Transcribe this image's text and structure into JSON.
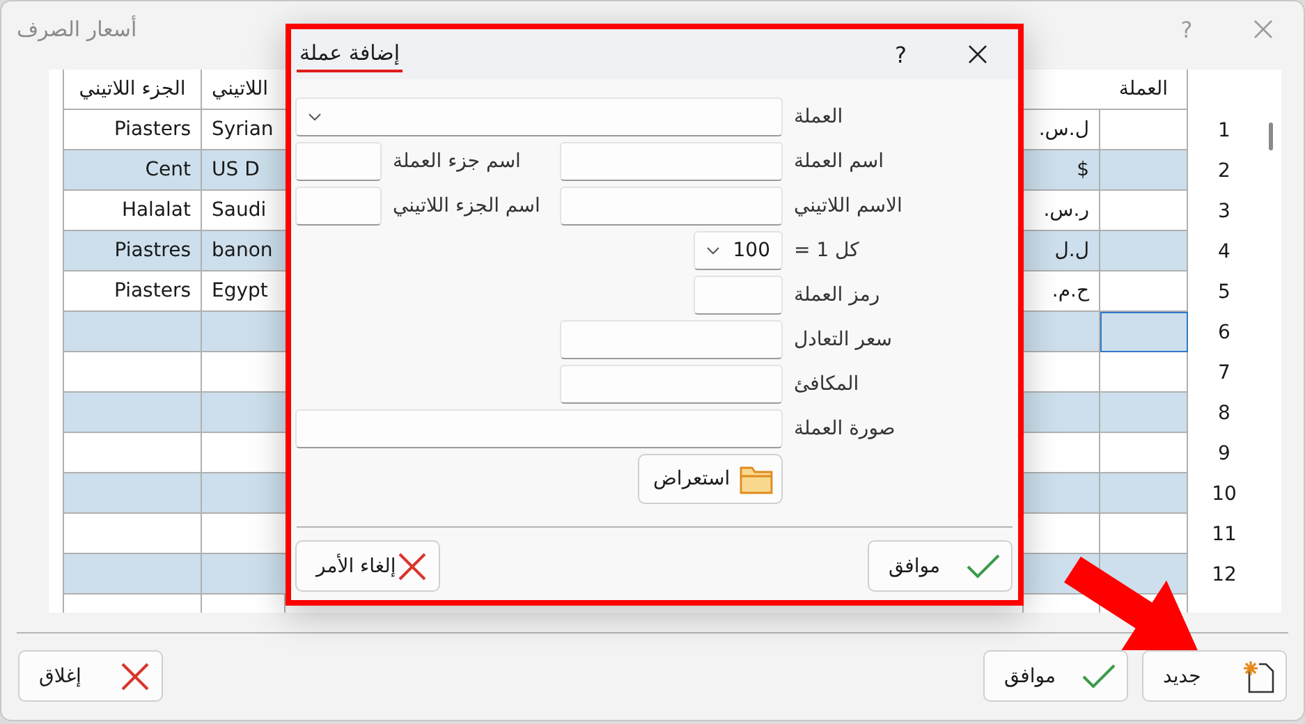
{
  "window": {
    "title": "أسعار الصرف",
    "help": "?"
  },
  "table": {
    "headers": {
      "latin_part": "الجزء اللاتيني",
      "latin_name": "اللاتيني",
      "currency": "العملة"
    },
    "rows": [
      {
        "number": "1",
        "latin_part": "Piasters",
        "latin_name": "Syrian",
        "column_3": "ل.س.",
        "selected": false
      },
      {
        "number": "2",
        "latin_part": "Cent",
        "latin_name": "US D",
        "column_3": "$",
        "selected": false
      },
      {
        "number": "3",
        "latin_part": "Halalat",
        "latin_name": "Saudi",
        "column_3": "ر.س.",
        "selected": false
      },
      {
        "number": "4",
        "latin_part": "Piastres",
        "latin_name": "banon",
        "column_3": "ل.ل",
        "selected": false
      },
      {
        "number": "5",
        "latin_part": "Piasters",
        "latin_name": "Egypt",
        "column_3": "ح.م.",
        "selected": false
      },
      {
        "number": "6",
        "selected": true
      },
      {
        "number": "7",
        "selected": false
      },
      {
        "number": "8",
        "selected": false
      },
      {
        "number": "9",
        "selected": false
      },
      {
        "number": "10",
        "selected": false
      },
      {
        "number": "11",
        "selected": false
      },
      {
        "number": "12",
        "selected": false
      }
    ]
  },
  "dialog": {
    "title": "إضافة عملة",
    "help": "?",
    "currency_label": "العملة",
    "currency_name_label": "اسم العملة",
    "subunit_name_label": "اسم جزء العملة",
    "latin_name_label": "الاسم اللاتيني",
    "latin_subunit_label": "اسم الجزء اللاتيني",
    "per_one_label": "كل 1 =",
    "per_one_value": "100",
    "symbol_label": "رمز العملة",
    "parity_label": "سعر التعادل",
    "equivalent_label": "المكافئ",
    "image_label": "صورة العملة",
    "browse_button": "استعراض",
    "ok_button": "موافق",
    "cancel_button": "إلغاء الأمر"
  },
  "buttons": [
    {
      "label": "جديد",
      "kind": "new"
    },
    {
      "label": "موافق",
      "kind": "ok"
    },
    {
      "label": "إغلاق",
      "kind": "close"
    }
  ]
}
